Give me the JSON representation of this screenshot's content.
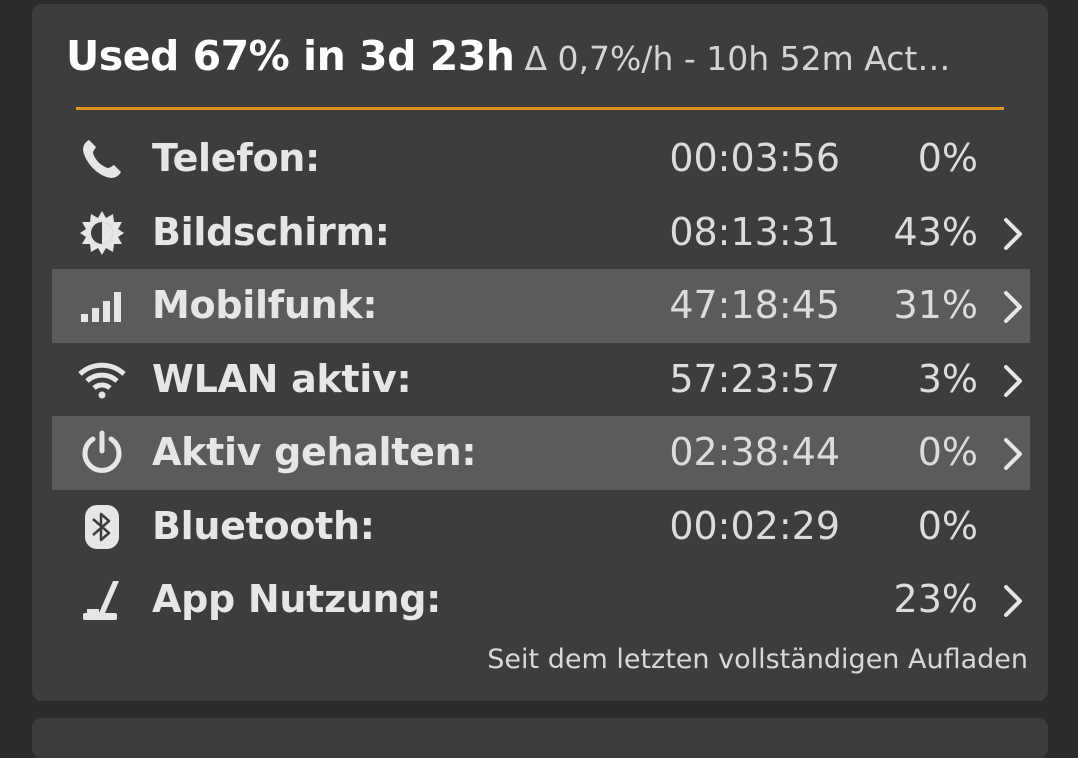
{
  "header": {
    "main": "Used 67% in 3d 23h",
    "sub": "Δ 0,7%/h - 10h 52m Act…"
  },
  "colors": {
    "accent": "#e0921e",
    "card_bg": "#3d3d3d",
    "row_highlight": "#5b5b5b"
  },
  "rows": [
    {
      "icon": "phone-icon",
      "label": "Telefon:",
      "time": "00:03:56",
      "pct": "0%",
      "chevron": false,
      "highlight": false
    },
    {
      "icon": "brightness-icon",
      "label": "Bildschirm:",
      "time": "08:13:31",
      "pct": "43%",
      "chevron": true,
      "highlight": false
    },
    {
      "icon": "signal-bars-icon",
      "label": "Mobilfunk:",
      "time": "47:18:45",
      "pct": "31%",
      "chevron": true,
      "highlight": true
    },
    {
      "icon": "wifi-icon",
      "label": "WLAN aktiv:",
      "time": "57:23:57",
      "pct": "3%",
      "chevron": true,
      "highlight": false
    },
    {
      "icon": "power-icon",
      "label": "Aktiv gehalten:",
      "time": "02:38:44",
      "pct": "0%",
      "chevron": true,
      "highlight": true
    },
    {
      "icon": "bluetooth-icon",
      "label": "Bluetooth:",
      "time": "00:02:29",
      "pct": "0%",
      "chevron": false,
      "highlight": false
    },
    {
      "icon": "app-usage-icon",
      "label": "App Nutzung:",
      "time": "",
      "pct": "23%",
      "chevron": true,
      "highlight": false
    }
  ],
  "footer": "Seit dem letzten vollständigen Aufladen"
}
